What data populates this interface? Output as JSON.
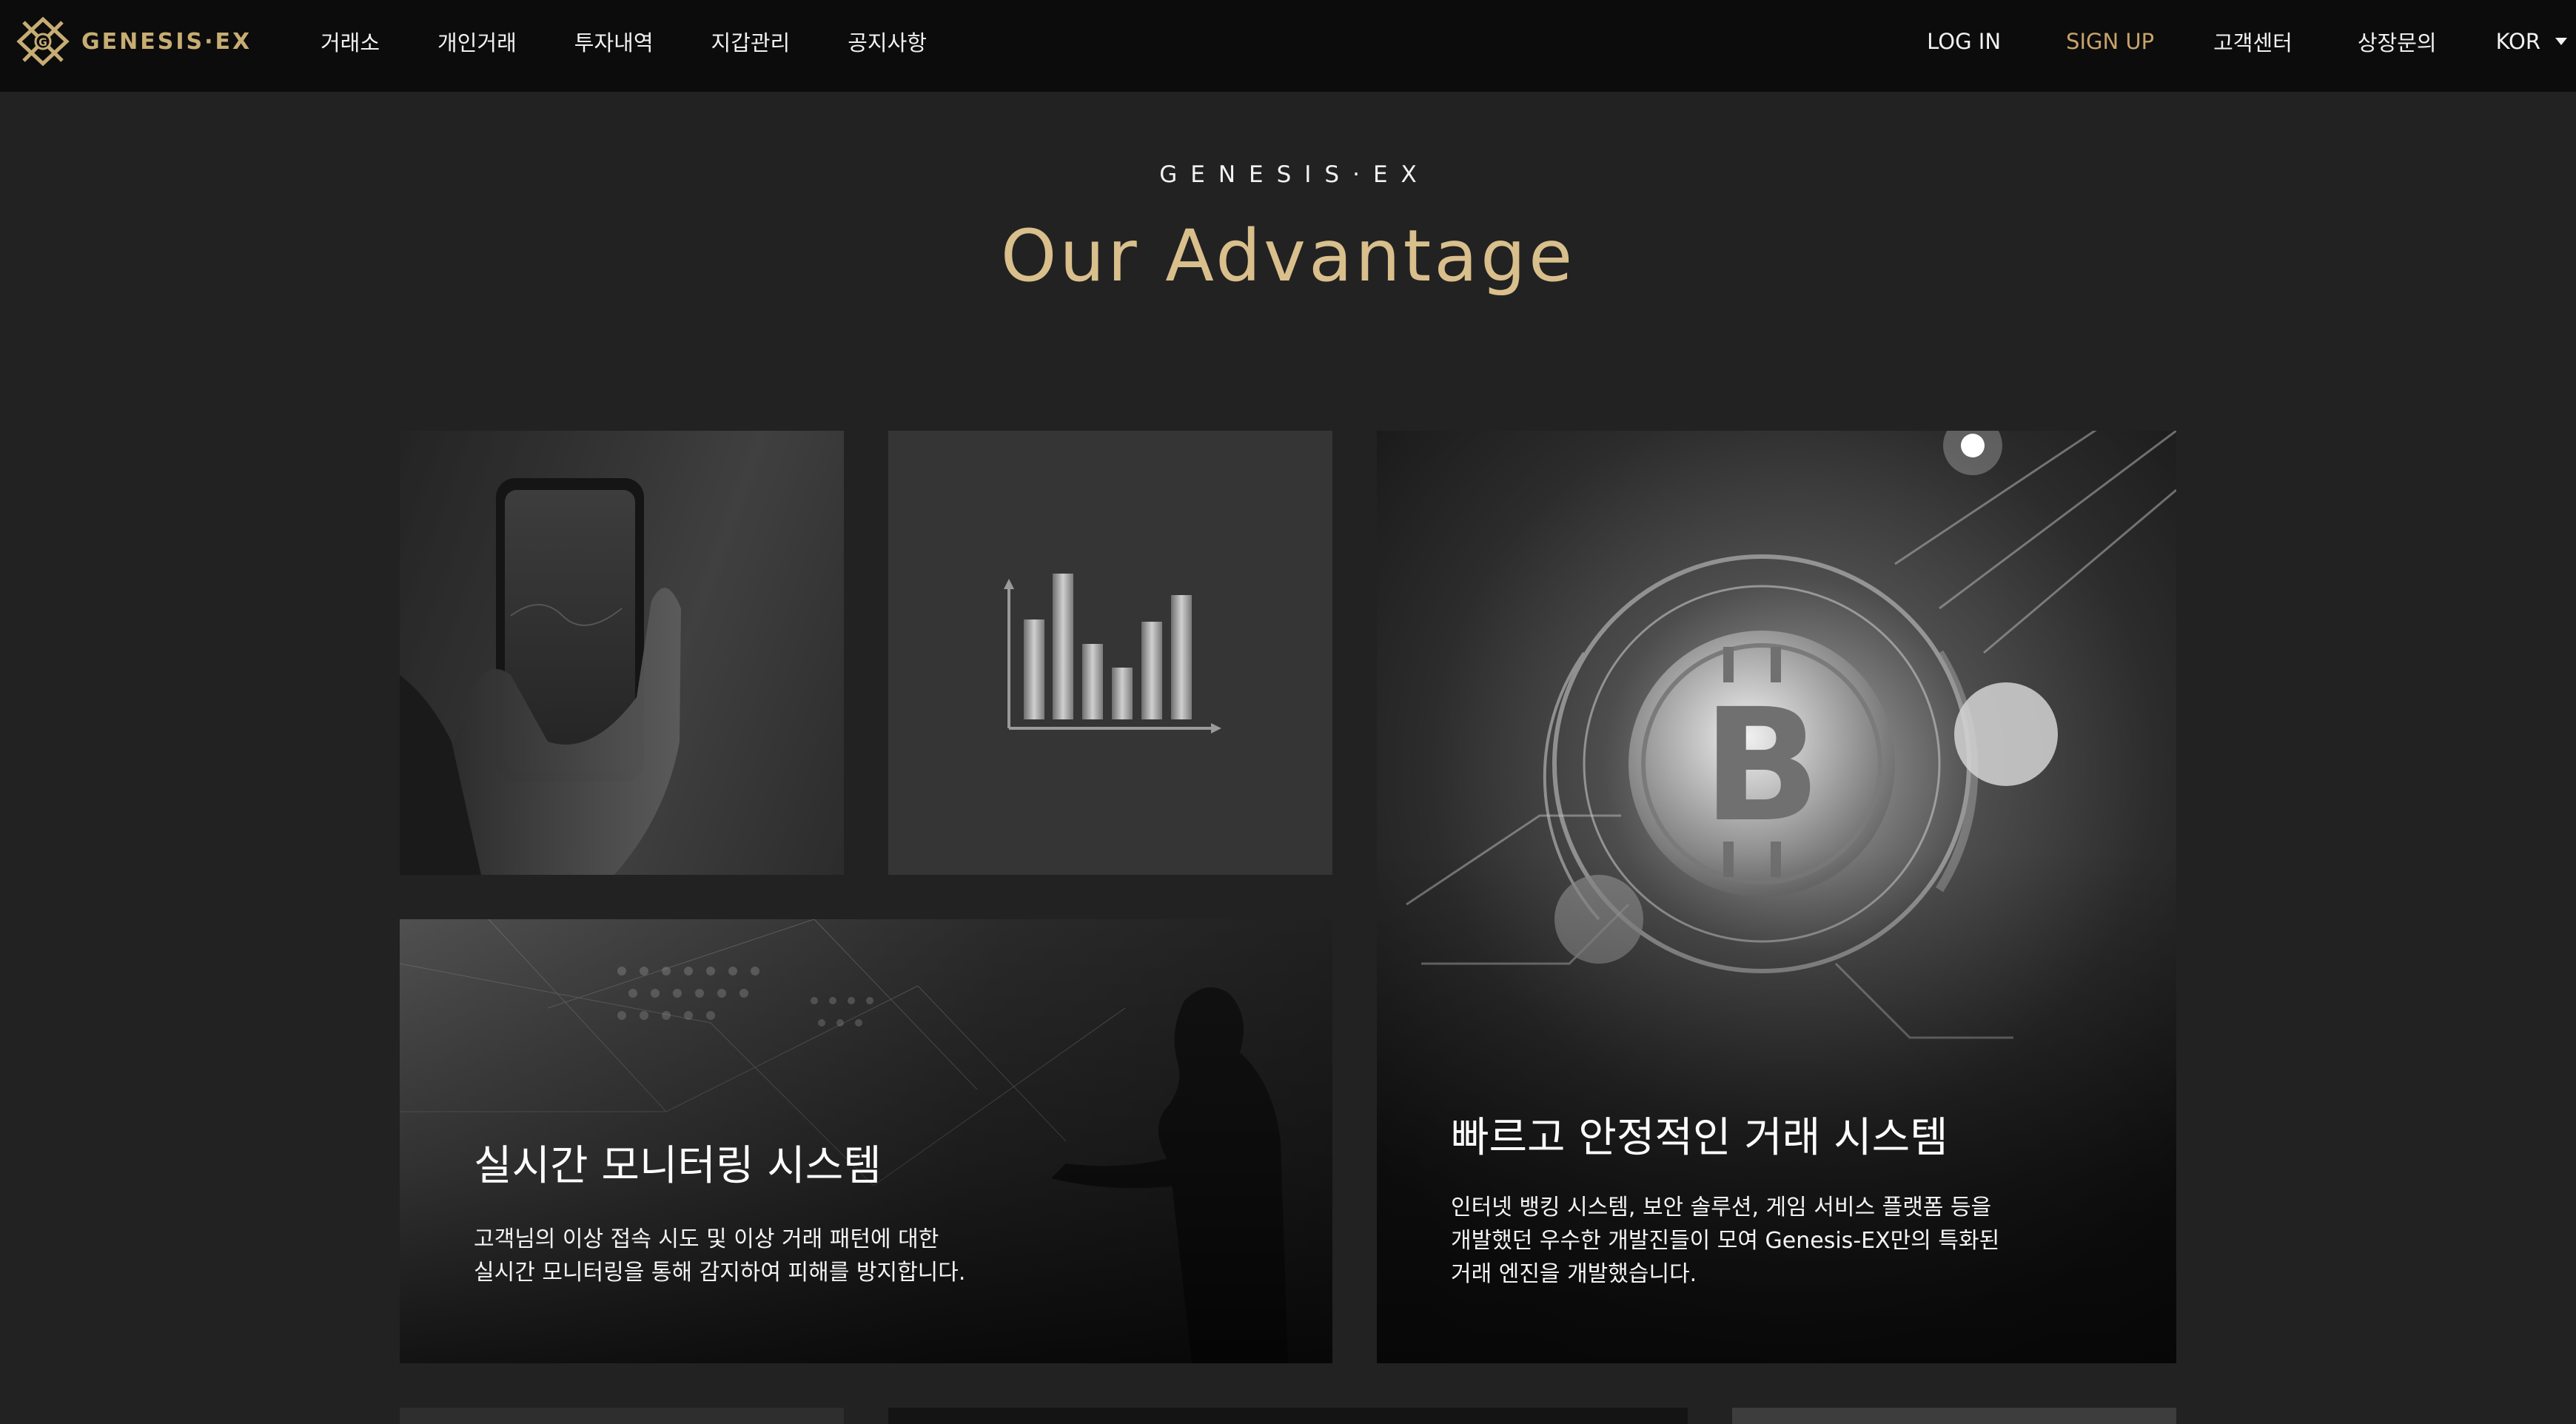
{
  "brand": {
    "name": "GENESIS·EX",
    "accent_color": "#c7ad73"
  },
  "nav": {
    "left_items": [
      {
        "label": "거래소"
      },
      {
        "label": "개인거래"
      },
      {
        "label": "투자내역"
      },
      {
        "label": "지갑관리"
      },
      {
        "label": "공지사항"
      }
    ],
    "login_label": "LOG IN",
    "signup_label": "SIGN UP",
    "support_label": "고객센터",
    "listing_label": "상장문의",
    "language": "KOR"
  },
  "hero": {
    "eyebrow": "GENESIS·EX",
    "title": "Our Advantage"
  },
  "cards": {
    "monitoring": {
      "title": "실시간 모니터링 시스템",
      "desc_line1": "고객님의 이상 접속 시도 및 이상 거래 패턴에 대한",
      "desc_line2": "실시간 모니터링을 통해 감지하여 피해를 방지합니다."
    },
    "trading": {
      "title": "빠르고 안정적인 거래 시스템",
      "desc_line1": "인터넷 뱅킹 시스템, 보안 솔루션, 게임 서비스 플랫폼 등을",
      "desc_line2": "개발했던 우수한 개발진들이 모여 Genesis-EX만의 특화된",
      "desc_line3": "거래 엔진을 개발했습니다."
    }
  },
  "icons": {
    "logo": "genesis-diamond-logo-icon",
    "chart": "bar-chart-icon",
    "language_caret": "caret-down-icon"
  }
}
